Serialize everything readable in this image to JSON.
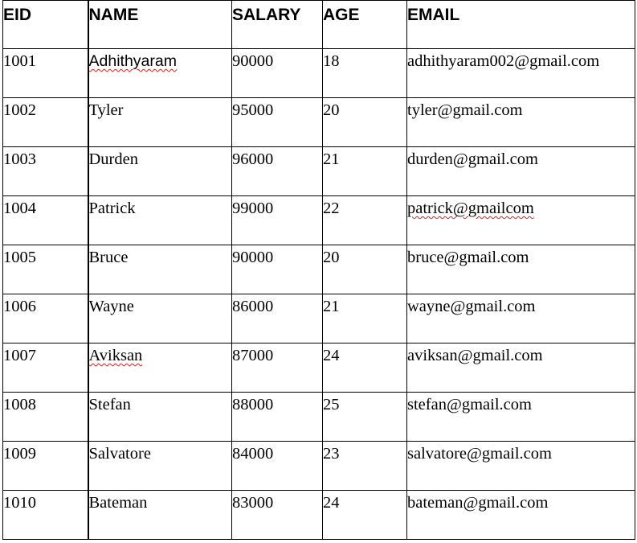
{
  "table": {
    "headers": [
      "EID",
      "NAME",
      "SALARY",
      "AGE",
      "EMAIL"
    ],
    "rows": [
      {
        "eid": "1001",
        "name": "Adhithyaram",
        "salary": "90000",
        "age": "18",
        "email": "adhithyaram002@gmail.com"
      },
      {
        "eid": "1002",
        "name": "Tyler",
        "salary": "95000",
        "age": "20",
        "email": "tyler@gmail.com"
      },
      {
        "eid": "1003",
        "name": "Durden",
        "salary": "96000",
        "age": "21",
        "email": "durden@gmail.com"
      },
      {
        "eid": "1004",
        "name": "Patrick",
        "salary": "99000",
        "age": "22",
        "email": "patrick@gmailcom"
      },
      {
        "eid": "1005",
        "name": "Bruce",
        "salary": "90000",
        "age": "20",
        "email": "bruce@gmail.com"
      },
      {
        "eid": "1006",
        "name": "Wayne",
        "salary": "86000",
        "age": "21",
        "email": "wayne@gmail.com"
      },
      {
        "eid": "1007",
        "name": "Aviksan",
        "salary": "87000",
        "age": "24",
        "email": "aviksan@gmail.com"
      },
      {
        "eid": "1008",
        "name": "Stefan",
        "salary": "88000",
        "age": "25",
        "email": "stefan@gmail.com"
      },
      {
        "eid": "1009",
        "name": "Salvatore",
        "salary": "84000",
        "age": "23",
        "email": "salvatore@gmail.com"
      },
      {
        "eid": "1010",
        "name": "Bateman",
        "salary": "83000",
        "age": "24",
        "email": "bateman@gmail.com"
      }
    ]
  },
  "spellcheck_color": "#e02020"
}
